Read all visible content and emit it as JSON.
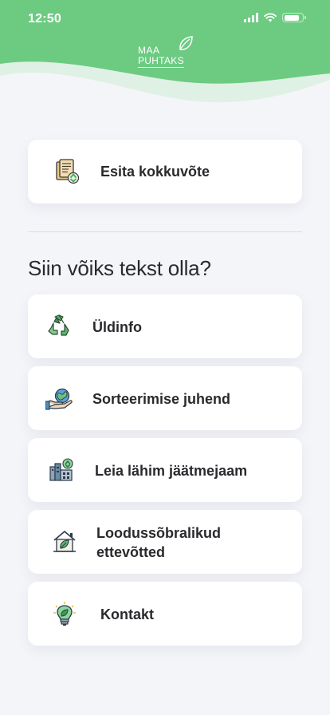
{
  "status_bar": {
    "time": "12:50"
  },
  "header": {
    "logo_line1": "MAA",
    "logo_line2": "PUHTAKS",
    "bg_color": "#6ccb81",
    "wave_color": "#dff1e4"
  },
  "summary_card": {
    "label": "Esita kokkuvõte",
    "icon": "document-recycle-icon"
  },
  "section": {
    "title": "Siin võiks tekst olla?"
  },
  "menu": [
    {
      "label": "Üldinfo",
      "icon": "recycle-icon"
    },
    {
      "label": "Sorteerimise juhend",
      "icon": "globe-hand-icon"
    },
    {
      "label": "Leia lähim jäätmejaam",
      "icon": "factory-recycle-icon"
    },
    {
      "label_line1": "Loodussõbralikud",
      "label_line2": "ettevõtted",
      "icon": "eco-house-icon"
    },
    {
      "label": "Kontakt",
      "icon": "eco-lightbulb-icon"
    }
  ]
}
